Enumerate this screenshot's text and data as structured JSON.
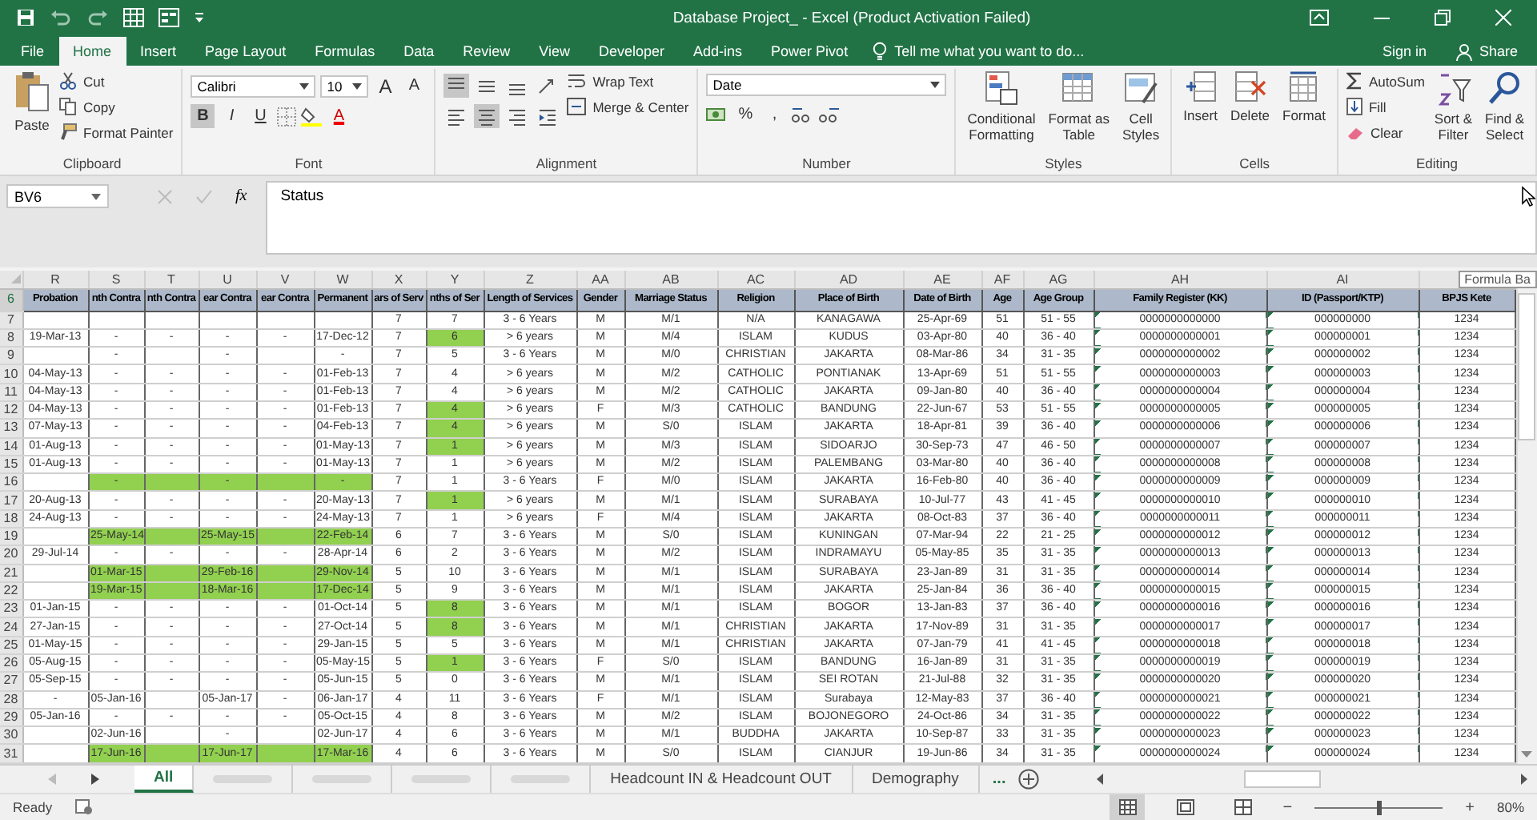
{
  "window": {
    "title": "Database Project_ - Excel (Product Activation Failed)"
  },
  "menu_tabs": [
    {
      "label": "File",
      "selected": false
    },
    {
      "label": "Home",
      "selected": true
    },
    {
      "label": "Insert",
      "selected": false
    },
    {
      "label": "Page Layout",
      "selected": false
    },
    {
      "label": "Formulas",
      "selected": false
    },
    {
      "label": "Data",
      "selected": false
    },
    {
      "label": "Review",
      "selected": false
    },
    {
      "label": "View",
      "selected": false
    },
    {
      "label": "Developer",
      "selected": false
    },
    {
      "label": "Add-ins",
      "selected": false
    },
    {
      "label": "Power Pivot",
      "selected": false
    }
  ],
  "tell_me": "Tell me what you want to do...",
  "sign_in": "Sign in",
  "share": "Share",
  "ribbon": {
    "clipboard": {
      "title": "Clipboard",
      "paste": "Paste",
      "cut": "Cut",
      "copy": "Copy",
      "format_painter": "Format Painter"
    },
    "font": {
      "title": "Font",
      "font_name": "Calibri",
      "font_size": "10",
      "grow": "A",
      "shrink": "A",
      "font_color": "A",
      "styles": [
        {
          "label": "B",
          "on": true
        },
        {
          "label": "I",
          "on": false
        },
        {
          "label": "U",
          "on": false
        }
      ]
    },
    "alignment": {
      "title": "Alignment",
      "wrap_text": "Wrap Text",
      "merge_center": "Merge & Center",
      "vertical": [
        {
          "on": true
        },
        {
          "on": false
        },
        {
          "on": false
        }
      ],
      "horizontal": [
        {
          "on": false
        },
        {
          "on": true
        },
        {
          "on": false
        }
      ]
    },
    "number": {
      "title": "Number",
      "format": "Date",
      "percent": "%",
      "comma": ","
    },
    "styles": {
      "title": "Styles",
      "conditional": [
        "Conditional",
        "Formatting"
      ],
      "format_table": [
        "Format as",
        "Table"
      ],
      "cell_styles": [
        "Cell",
        "Styles"
      ]
    },
    "cells": {
      "title": "Cells",
      "insert": "Insert",
      "delete": "Delete",
      "format": "Format"
    },
    "editing": {
      "title": "Editing",
      "autosum": "AutoSum",
      "fill": "Fill",
      "clear": "Clear",
      "sort": [
        "Sort &",
        "Filter"
      ],
      "find": [
        "Find &",
        "Select"
      ]
    }
  },
  "formula_bar": {
    "name_box": "BV6",
    "fx": "fx",
    "value": "Status",
    "tooltip": "Formula Ba"
  },
  "columns": [
    {
      "letter": "R",
      "header": "Probation"
    },
    {
      "letter": "S",
      "header": "nth Contra"
    },
    {
      "letter": "T",
      "header": "nth Contra"
    },
    {
      "letter": "U",
      "header": "ear Contra"
    },
    {
      "letter": "V",
      "header": "ear Contra"
    },
    {
      "letter": "W",
      "header": "Permanent"
    },
    {
      "letter": "X",
      "header": "ars of Serv"
    },
    {
      "letter": "Y",
      "header": "nths of Ser"
    },
    {
      "letter": "Z",
      "header": "Length of Services"
    },
    {
      "letter": "AA",
      "header": "Gender"
    },
    {
      "letter": "AB",
      "header": "Marriage Status"
    },
    {
      "letter": "AC",
      "header": "Religion"
    },
    {
      "letter": "AD",
      "header": "Place of Birth"
    },
    {
      "letter": "AE",
      "header": "Date of Birth"
    },
    {
      "letter": "AF",
      "header": "Age"
    },
    {
      "letter": "AG",
      "header": "Age Group"
    },
    {
      "letter": "AH",
      "header": "Family Register (KK)"
    },
    {
      "letter": "AI",
      "header": "ID (Passport/KTP)"
    },
    {
      "header": "BPJS Kete"
    }
  ],
  "header_row": {
    "num": "6",
    "selected": true
  },
  "rows": [
    {
      "num": "7",
      "cells": [
        null,
        null,
        null,
        null,
        null,
        null,
        "7",
        "7",
        "3 - 6 Years",
        "M",
        "M/1",
        "N/A",
        "KANAGAWA",
        "25-Apr-69",
        "51",
        "51 - 55",
        "0000000000000",
        "000000000",
        "1234"
      ],
      "highlight": [
        false,
        false,
        false,
        false,
        false,
        false,
        false,
        false
      ]
    },
    {
      "num": "8",
      "cells": [
        "19-Mar-13",
        "-",
        "-",
        "-",
        "-",
        "17-Dec-12",
        "7",
        "6",
        "> 6 years",
        "M",
        "M/4",
        "ISLAM",
        "KUDUS",
        "03-Apr-80",
        "40",
        "36 - 40",
        "0000000000001",
        "000000001",
        "1234"
      ],
      "highlight": [
        false,
        false,
        false,
        false,
        false,
        false,
        false,
        true
      ]
    },
    {
      "num": "9",
      "cells": [
        null,
        "-",
        null,
        "-",
        null,
        "-",
        "7",
        "5",
        "3 - 6 Years",
        "M",
        "M/0",
        "CHRISTIAN",
        "JAKARTA",
        "08-Mar-86",
        "34",
        "31 - 35",
        "0000000000002",
        "000000002",
        "1234"
      ],
      "highlight": [
        false,
        false,
        false,
        false,
        false,
        false,
        false,
        false
      ]
    },
    {
      "num": "10",
      "cells": [
        "04-May-13",
        "-",
        "-",
        "-",
        "-",
        "01-Feb-13",
        "7",
        "4",
        "> 6 years",
        "M",
        "M/2",
        "CATHOLIC",
        "PONTIANAK",
        "13-Apr-69",
        "51",
        "51 - 55",
        "0000000000003",
        "000000003",
        "1234"
      ],
      "highlight": [
        false,
        false,
        false,
        false,
        false,
        false,
        false,
        false
      ]
    },
    {
      "num": "11",
      "cells": [
        "04-May-13",
        "-",
        "-",
        "-",
        "-",
        "01-Feb-13",
        "7",
        "4",
        "> 6 years",
        "M",
        "M/2",
        "CATHOLIC",
        "JAKARTA",
        "09-Jan-80",
        "40",
        "36 - 40",
        "0000000000004",
        "000000004",
        "1234"
      ],
      "highlight": [
        false,
        false,
        false,
        false,
        false,
        false,
        false,
        false
      ]
    },
    {
      "num": "12",
      "cells": [
        "04-May-13",
        "-",
        "-",
        "-",
        "-",
        "01-Feb-13",
        "7",
        "4",
        "> 6 years",
        "F",
        "M/3",
        "CATHOLIC",
        "BANDUNG",
        "22-Jun-67",
        "53",
        "51 - 55",
        "0000000000005",
        "000000005",
        "1234"
      ],
      "highlight": [
        false,
        false,
        false,
        false,
        false,
        false,
        false,
        true
      ]
    },
    {
      "num": "13",
      "cells": [
        "07-May-13",
        "-",
        "-",
        "-",
        "-",
        "04-Feb-13",
        "7",
        "4",
        "> 6 years",
        "M",
        "S/0",
        "ISLAM",
        "JAKARTA",
        "18-Apr-81",
        "39",
        "36 - 40",
        "0000000000006",
        "000000006",
        "1234"
      ],
      "highlight": [
        false,
        false,
        false,
        false,
        false,
        false,
        false,
        true
      ]
    },
    {
      "num": "14",
      "cells": [
        "01-Aug-13",
        "-",
        "-",
        "-",
        "-",
        "01-May-13",
        "7",
        "1",
        "> 6 years",
        "M",
        "M/3",
        "ISLAM",
        "SIDOARJO",
        "30-Sep-73",
        "47",
        "46 - 50",
        "0000000000007",
        "000000007",
        "1234"
      ],
      "highlight": [
        false,
        false,
        false,
        false,
        false,
        false,
        false,
        true
      ]
    },
    {
      "num": "15",
      "cells": [
        "01-Aug-13",
        "-",
        "-",
        "-",
        "-",
        "01-May-13",
        "7",
        "1",
        "> 6 years",
        "M",
        "M/2",
        "ISLAM",
        "PALEMBANG",
        "03-Mar-80",
        "40",
        "36 - 40",
        "0000000000008",
        "000000008",
        "1234"
      ],
      "highlight": [
        false,
        false,
        false,
        false,
        false,
        false,
        false,
        false
      ]
    },
    {
      "num": "16",
      "cells": [
        null,
        "-",
        null,
        "-",
        null,
        "-",
        "7",
        "1",
        "3 - 6 Years",
        "F",
        "M/0",
        "ISLAM",
        "JAKARTA",
        "16-Feb-80",
        "40",
        "36 - 40",
        "0000000000009",
        "000000009",
        "1234"
      ],
      "highlight": [
        false,
        true,
        true,
        true,
        true,
        true,
        false,
        false
      ]
    },
    {
      "num": "17",
      "cells": [
        "20-Aug-13",
        "-",
        "-",
        "-",
        "-",
        "20-May-13",
        "7",
        "1",
        "> 6 years",
        "M",
        "M/1",
        "ISLAM",
        "SURABAYA",
        "10-Jul-77",
        "43",
        "41 - 45",
        "0000000000010",
        "000000010",
        "1234"
      ],
      "highlight": [
        false,
        false,
        false,
        false,
        false,
        false,
        false,
        true
      ]
    },
    {
      "num": "18",
      "cells": [
        "24-Aug-13",
        "-",
        "-",
        "-",
        "-",
        "24-May-13",
        "7",
        "1",
        "> 6 years",
        "F",
        "M/4",
        "ISLAM",
        "JAKARTA",
        "08-Oct-83",
        "37",
        "36 - 40",
        "0000000000011",
        "000000011",
        "1234"
      ],
      "highlight": [
        false,
        false,
        false,
        false,
        false,
        false,
        false,
        false
      ]
    },
    {
      "num": "19",
      "cells": [
        null,
        "25-May-14",
        null,
        "25-May-15",
        null,
        "22-Feb-14",
        "6",
        "7",
        "3 - 6 Years",
        "M",
        "S/0",
        "ISLAM",
        "KUNINGAN",
        "07-Mar-94",
        "22",
        "21 - 25",
        "0000000000012",
        "000000012",
        "1234"
      ],
      "highlight": [
        false,
        true,
        true,
        true,
        true,
        true,
        false,
        false
      ]
    },
    {
      "num": "20",
      "cells": [
        "29-Jul-14",
        "-",
        "-",
        "-",
        "-",
        "28-Apr-14",
        "6",
        "2",
        "3 - 6 Years",
        "M",
        "M/2",
        "ISLAM",
        "INDRAMAYU",
        "05-May-85",
        "35",
        "31 - 35",
        "0000000000013",
        "000000013",
        "1234"
      ],
      "highlight": [
        false,
        false,
        false,
        false,
        false,
        false,
        false,
        false
      ]
    },
    {
      "num": "21",
      "cells": [
        null,
        "01-Mar-15",
        null,
        "29-Feb-16",
        null,
        "29-Nov-14",
        "5",
        "10",
        "3 - 6 Years",
        "M",
        "M/1",
        "ISLAM",
        "SURABAYA",
        "23-Jan-89",
        "31",
        "31 - 35",
        "0000000000014",
        "000000014",
        "1234"
      ],
      "highlight": [
        false,
        true,
        true,
        true,
        true,
        true,
        false,
        false
      ]
    },
    {
      "num": "22",
      "cells": [
        null,
        "19-Mar-15",
        null,
        "18-Mar-16",
        null,
        "17-Dec-14",
        "5",
        "9",
        "3 - 6 Years",
        "M",
        "M/1",
        "ISLAM",
        "JAKARTA",
        "25-Jan-84",
        "36",
        "36 - 40",
        "0000000000015",
        "000000015",
        "1234"
      ],
      "highlight": [
        false,
        true,
        true,
        true,
        true,
        true,
        false,
        false
      ]
    },
    {
      "num": "23",
      "cells": [
        "01-Jan-15",
        "-",
        "-",
        "-",
        "-",
        "01-Oct-14",
        "5",
        "8",
        "3 - 6 Years",
        "M",
        "M/1",
        "ISLAM",
        "BOGOR",
        "13-Jan-83",
        "37",
        "36 - 40",
        "0000000000016",
        "000000016",
        "1234"
      ],
      "highlight": [
        false,
        false,
        false,
        false,
        false,
        false,
        false,
        true
      ]
    },
    {
      "num": "24",
      "cells": [
        "27-Jan-15",
        "-",
        "-",
        "-",
        "-",
        "27-Oct-14",
        "5",
        "8",
        "3 - 6 Years",
        "M",
        "M/1",
        "CHRISTIAN",
        "JAKARTA",
        "17-Nov-89",
        "31",
        "31 - 35",
        "0000000000017",
        "000000017",
        "1234"
      ],
      "highlight": [
        false,
        false,
        false,
        false,
        false,
        false,
        false,
        true
      ]
    },
    {
      "num": "25",
      "cells": [
        "01-May-15",
        "-",
        "-",
        "-",
        "-",
        "29-Jan-15",
        "5",
        "5",
        "3 - 6 Years",
        "M",
        "M/1",
        "CHRISTIAN",
        "JAKARTA",
        "07-Jan-79",
        "41",
        "41 - 45",
        "0000000000018",
        "000000018",
        "1234"
      ],
      "highlight": [
        false,
        false,
        false,
        false,
        false,
        false,
        false,
        false
      ]
    },
    {
      "num": "26",
      "cells": [
        "05-Aug-15",
        "-",
        "-",
        "-",
        "-",
        "05-May-15",
        "5",
        "1",
        "3 - 6 Years",
        "F",
        "S/0",
        "ISLAM",
        "BANDUNG",
        "16-Jan-89",
        "31",
        "31 - 35",
        "0000000000019",
        "000000019",
        "1234"
      ],
      "highlight": [
        false,
        false,
        false,
        false,
        false,
        false,
        false,
        true
      ]
    },
    {
      "num": "27",
      "cells": [
        "05-Sep-15",
        "-",
        "-",
        "-",
        "-",
        "05-Jun-15",
        "5",
        "0",
        "3 - 6 Years",
        "M",
        "M/1",
        "ISLAM",
        "SEI ROTAN",
        "21-Jul-88",
        "32",
        "31 - 35",
        "0000000000020",
        "000000020",
        "1234"
      ],
      "highlight": [
        false,
        false,
        false,
        false,
        false,
        false,
        false,
        false
      ]
    },
    {
      "num": "28",
      "cells": [
        "-",
        "05-Jan-16",
        null,
        "05-Jan-17",
        "-",
        "06-Jan-17",
        "4",
        "11",
        "3 - 6 Years",
        "F",
        "M/1",
        "ISLAM",
        "Surabaya",
        "12-May-83",
        "37",
        "36 - 40",
        "0000000000021",
        "000000021",
        "1234"
      ],
      "highlight": [
        false,
        false,
        false,
        false,
        false,
        false,
        false,
        false
      ]
    },
    {
      "num": "29",
      "cells": [
        "05-Jan-16",
        "-",
        "-",
        "-",
        "-",
        "05-Oct-15",
        "4",
        "8",
        "3 - 6 Years",
        "M",
        "M/2",
        "ISLAM",
        "BOJONEGORO",
        "24-Oct-86",
        "34",
        "31 - 35",
        "0000000000022",
        "000000022",
        "1234"
      ],
      "highlight": [
        false,
        false,
        false,
        false,
        false,
        false,
        false,
        false
      ]
    },
    {
      "num": "30",
      "cells": [
        null,
        "02-Jun-16",
        null,
        "-",
        null,
        "02-Jun-17",
        "4",
        "6",
        "3 - 6 Years",
        "M",
        "M/1",
        "BUDDHA",
        "JAKARTA",
        "10-Sep-87",
        "33",
        "31 - 35",
        "0000000000023",
        "000000023",
        "1234"
      ],
      "highlight": [
        false,
        false,
        false,
        false,
        false,
        false,
        false,
        false
      ]
    },
    {
      "num": "31",
      "cells": [
        null,
        "17-Jun-16",
        null,
        "17-Jun-17",
        null,
        "17-Mar-16",
        "4",
        "6",
        "3 - 6 Years",
        "M",
        "S/0",
        "ISLAM",
        "CIANJUR",
        "19-Jun-86",
        "34",
        "31 - 35",
        "0000000000024",
        "000000024",
        "1234"
      ],
      "highlight": [
        false,
        true,
        true,
        true,
        true,
        true,
        false,
        false
      ]
    }
  ],
  "sheet_tabs": [
    {
      "kind": "named",
      "label": "All",
      "selected": true
    },
    {
      "kind": "blurred",
      "selected": false
    },
    {
      "kind": "blurred",
      "selected": false
    },
    {
      "kind": "blurred",
      "selected": false
    },
    {
      "kind": "blurred",
      "selected": false
    },
    {
      "kind": "named",
      "label": "Headcount IN & Headcount OUT",
      "selected": false
    },
    {
      "kind": "named",
      "label": "Demography",
      "selected": false
    }
  ],
  "more_tabs": "...",
  "status_bar": {
    "status": "Ready",
    "views": [
      {
        "selected": true
      },
      {
        "selected": false
      },
      {
        "selected": false
      }
    ],
    "zoom": {
      "minus": "−",
      "plus": "+",
      "label": "80%",
      "level": 0.5
    }
  }
}
